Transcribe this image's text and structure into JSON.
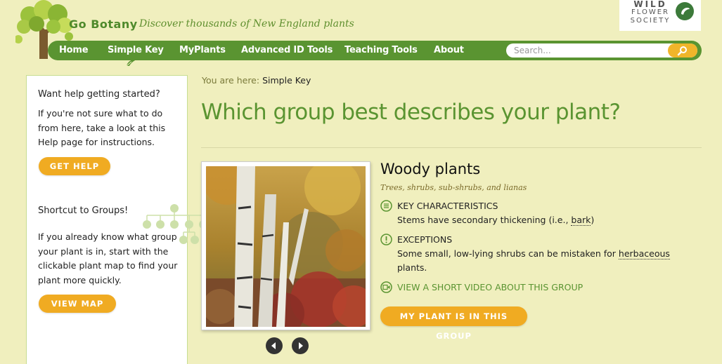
{
  "header": {
    "brand": "Go Botany",
    "tagline": "Discover thousands of New England plants",
    "society_lines": [
      "WILD",
      "FLOWER",
      "SOCIETY"
    ]
  },
  "nav": {
    "items": [
      {
        "label": "Home",
        "active": false
      },
      {
        "label": "Simple Key",
        "active": true
      },
      {
        "label": "MyPlants",
        "active": false
      },
      {
        "label": "Advanced ID Tools",
        "active": false
      },
      {
        "label": "Teaching Tools",
        "active": false
      },
      {
        "label": "About",
        "active": false
      }
    ],
    "search_placeholder": "Search...",
    "search_icon": "search-icon"
  },
  "sidebar": {
    "help_heading": "Want help getting started?",
    "help_text": "If you're not sure what to do from here, take a look at this Help page for instructions.",
    "help_button": "GET HELP",
    "groups_heading": "Shortcut to Groups!",
    "groups_text": "If you already know what group your plant is in, start with the clickable plant map to find your plant more quickly.",
    "map_button": "VIEW MAP"
  },
  "main": {
    "breadcrumb_label": "You are here:",
    "breadcrumb_current": "Simple Key",
    "title": "Which group best describes your plant?",
    "group": {
      "name": "Woody plants",
      "subtitle": "Trees, shrubs, sub-shrubs, and lianas",
      "key_heading": "KEY CHARACTERISTICS",
      "key_text_pre": "Stems have secondary thickening (i.e., ",
      "key_text_link": "bark",
      "key_text_post": ")",
      "exceptions_heading": "EXCEPTIONS",
      "exceptions_pre": "Some small, low-lying shrubs can be mistaken for ",
      "exceptions_link": "herbaceous",
      "exceptions_post": "plants.",
      "video_link": "VIEW A SHORT VIDEO ABOUT THIS GROUP",
      "button": "MY PLANT IS IN THIS GROUP"
    }
  },
  "colors": {
    "background": "#f0efbe",
    "nav_green": "#5a9431",
    "accent_orange": "#f0ab22",
    "title_green": "#5a9431"
  }
}
